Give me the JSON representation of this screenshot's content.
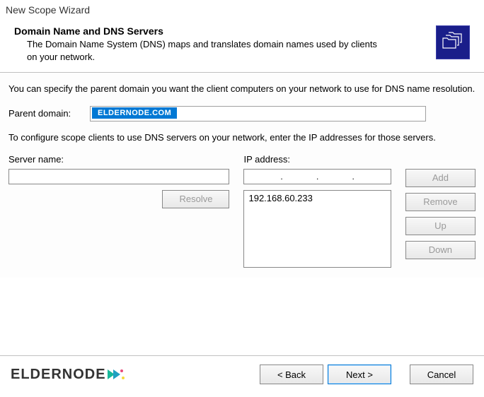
{
  "window": {
    "title": "New Scope Wizard"
  },
  "header": {
    "title": "Domain Name and DNS Servers",
    "description": "The Domain Name System (DNS) maps and translates domain names used by clients on your network."
  },
  "content": {
    "instruction1": "You can specify the parent domain you want the client computers on your network to use for DNS name resolution.",
    "parent_domain_label": "Parent domain:",
    "parent_domain_value": "ELDERNODE.COM",
    "instruction2": "To configure scope clients to use DNS servers on your network, enter the IP addresses for those servers.",
    "server_name_label": "Server name:",
    "server_name_value": "",
    "ip_address_label": "IP address:",
    "ip_address_value": "",
    "resolve_label": "Resolve",
    "ip_list": [
      "192.168.60.233"
    ],
    "buttons": {
      "add": "Add",
      "remove": "Remove",
      "up": "Up",
      "down": "Down"
    }
  },
  "footer": {
    "logo_text": "ELDERNODE",
    "back": "< Back",
    "next": "Next >",
    "cancel": "Cancel"
  }
}
